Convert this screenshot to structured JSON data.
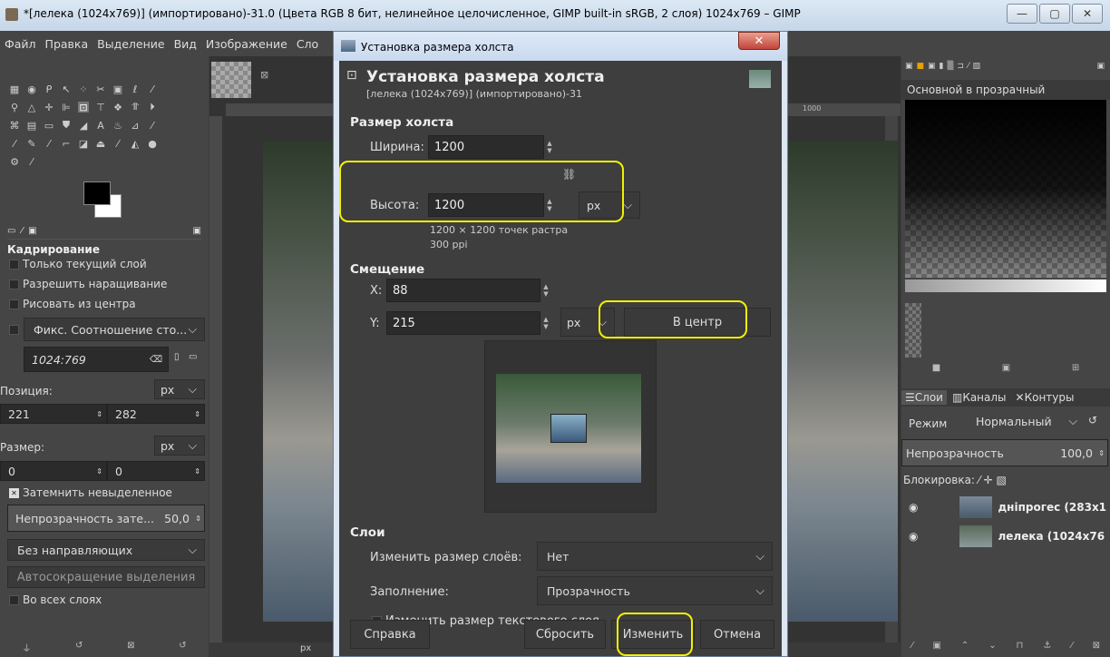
{
  "window": {
    "title": "*[лелека (1024x769)] (импортировано)-31.0 (Цвета RGB 8 бит, нелинейное целочисленное, GIMP built-in sRGB, 2 слоя) 1024x769 – GIMP"
  },
  "menu": [
    "Файл",
    "Правка",
    "Выделение",
    "Вид",
    "Изображение",
    "Сло"
  ],
  "tool_options": {
    "title": "Кадрирование",
    "current_layer_only": "Только текущий слой",
    "allow_growing": "Разрешить наращивание",
    "draw_from_center": "Рисовать из центра",
    "fixed_label": "Фикс. Соотношение сто...",
    "ratio_value": "1024:769",
    "position_label": "Позиция:",
    "position_unit": "px",
    "pos_x": "221",
    "pos_y": "282",
    "size_label": "Размер:",
    "size_unit": "px",
    "size_w": "0",
    "size_h": "0",
    "highlight": "Затемнить невыделенное",
    "highlight_opacity_label": "Непрозрачность зате...",
    "highlight_opacity_value": "50,0",
    "guides": "Без направляющих",
    "auto_shrink": "Автосокращение выделения",
    "all_layers": "Во всех слоях"
  },
  "canvas": {
    "ruler_mark": "1000",
    "unit": "px"
  },
  "right_panel": {
    "gradient_name": "Основной в прозрачный",
    "tabs": [
      "Слои",
      "Каналы",
      "Контуры"
    ],
    "mode_label": "Режим",
    "mode_value": "Нормальный",
    "opacity_label": "Непрозрачность",
    "opacity_value": "100,0",
    "lock_label": "Блокировка:",
    "layers": [
      {
        "name": "дніпрогес (283x1"
      },
      {
        "name": "лелека (1024x76"
      }
    ]
  },
  "dialog": {
    "window_title": "Установка размера холста",
    "heading": "Установка размера холста",
    "subheading": "[лелека (1024x769)] (импортировано)-31",
    "canvas_size_section": "Размер холста",
    "width_label": "Ширина:",
    "width_value": "1200",
    "height_label": "Высота:",
    "height_value": "1200",
    "size_unit": "px",
    "size_info": "1200 × 1200 точек растра",
    "resolution": "300 ppi",
    "offset_section": "Смещение",
    "x_label": "X:",
    "x_value": "88",
    "y_label": "Y:",
    "y_value": "215",
    "offset_unit": "px",
    "center_button": "В центр",
    "layers_section": "Слои",
    "resize_layers_label": "Изменить размер слоёв:",
    "resize_layers_value": "Нет",
    "fill_label": "Заполнение:",
    "fill_value": "Прозрачность",
    "resize_text_layers": "Изменить размер текстового слоя",
    "help_button": "Справка",
    "reset_button": "Сбросить",
    "resize_button": "Изменить",
    "cancel_button": "Отмена"
  },
  "colors": {
    "highlight": "#f4f000",
    "panel_bg": "#454545",
    "dialog_bg": "#3e3e3e"
  }
}
